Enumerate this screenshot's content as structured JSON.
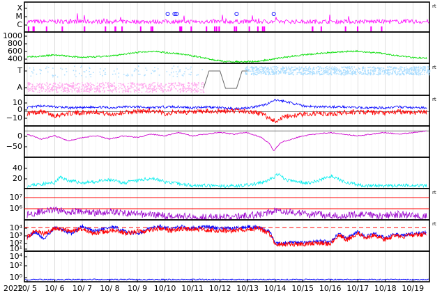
{
  "chart_data": {
    "type": "line",
    "year_label": "2022",
    "x_tick_labels": [
      "10/ 5",
      "10/ 6",
      "10/ 7",
      "10/ 8",
      "10/ 9",
      "10/10",
      "10/11",
      "10/12",
      "10/13",
      "10/14",
      "10/15",
      "10/16",
      "10/17",
      "10/18",
      "10/19"
    ],
    "x_range_days": [
      4.9,
      19.6
    ],
    "colors": {
      "xray": "#ff00ff",
      "speed": "#00dd00",
      "dens": "#00eeee",
      "bt": "#0000ff",
      "bz": "#ff0000",
      "dst": "#cc00cc",
      "pp_sector": "#aaddff",
      "m_sector": "#ffaaee",
      "e_prot": "#ffaa88",
      "e_elec": "#9900cc",
      "hp": "#0000ff",
      "hn": "#ff0000"
    },
    "panels": [
      {
        "id": "xray",
        "tick_labels": [
          "X",
          "M",
          "C"
        ],
        "rt_label": "rt",
        "flares_days": [
          10.1,
          10.35,
          10.42,
          12.6,
          13.95
        ]
      },
      {
        "id": "speed",
        "tick_labels": [
          "1000",
          "800",
          "600",
          "400"
        ],
        "ylim": [
          300,
          1050
        ],
        "series": [
          {
            "days": [
              5.0,
              5.5,
              6.0,
              6.5,
              7.0,
              7.5,
              8.0,
              8.5,
              9.0,
              9.5,
              10.0,
              10.5,
              11.0,
              11.4,
              11.8,
              12.2,
              12.6,
              13.0,
              13.4,
              13.8,
              14.2,
              14.6,
              15.0,
              15.5,
              16.0,
              16.5,
              17.0,
              17.5,
              18.0,
              18.5,
              19.0,
              19.5
            ],
            "values": [
              460,
              470,
              500,
              470,
              440,
              460,
              470,
              520,
              560,
              590,
              560,
              530,
              480,
              430,
              380,
              340,
              340,
              340,
              350,
              390,
              430,
              470,
              500,
              530,
              560,
              580,
              590,
              560,
              530,
              480,
              440,
              420
            ]
          }
        ]
      },
      {
        "id": "sector",
        "tick_labels": [
          "T",
          "A"
        ],
        "rt_label": "rt"
      },
      {
        "id": "imf",
        "tick_labels": [
          "10",
          "0",
          "−10"
        ],
        "ylim": [
          -15,
          17
        ],
        "rt_label": "rt",
        "series": [
          {
            "days": [
              5.0,
              5.5,
              6.0,
              6.5,
              7.0,
              7.5,
              8.0,
              8.5,
              9.0,
              9.5,
              10.0,
              10.5,
              11.0,
              11.5,
              12.0,
              12.5,
              13.0,
              13.5,
              13.8,
              14.0,
              14.3,
              14.6,
              15.0,
              15.5,
              16.0,
              16.5,
              17.0,
              17.5,
              18.0,
              18.5,
              19.0,
              19.5
            ],
            "values": [
              4,
              6,
              5,
              4,
              4,
              5,
              4,
              5,
              5,
              4,
              5,
              5,
              4,
              5,
              4,
              3,
              4,
              6,
              9,
              12,
              11,
              9,
              6,
              5,
              5,
              5,
              4,
              4,
              4,
              5,
              4,
              4
            ]
          },
          {
            "days": [
              5.0,
              5.5,
              6.0,
              6.5,
              7.0,
              7.5,
              8.0,
              8.5,
              9.0,
              9.5,
              10.0,
              10.5,
              11.0,
              11.5,
              12.0,
              12.5,
              13.0,
              13.5,
              13.8,
              14.0,
              14.3,
              14.6,
              15.0,
              15.5,
              16.0,
              16.5,
              17.0,
              17.5,
              18.0,
              18.5,
              19.0,
              19.5
            ],
            "values": [
              -2,
              0,
              -4,
              -2,
              -1,
              0,
              -3,
              -1,
              0,
              1,
              -2,
              0,
              -1,
              0,
              0,
              1,
              0,
              -2,
              -7,
              -10,
              -6,
              -4,
              -3,
              -2,
              -3,
              -1,
              0,
              -1,
              -2,
              0,
              -1,
              0
            ]
          }
        ]
      },
      {
        "id": "dst",
        "tick_labels": [
          "0",
          "−50"
        ],
        "ylim": [
          -80,
          15
        ],
        "series": [
          {
            "days": [
              5.0,
              5.5,
              6.0,
              6.5,
              7.0,
              7.5,
              8.0,
              8.5,
              9.0,
              9.5,
              10.0,
              10.5,
              11.0,
              11.5,
              12.0,
              12.5,
              13.0,
              13.5,
              13.8,
              13.95,
              14.2,
              14.6,
              15.0,
              15.5,
              16.0,
              16.5,
              17.0,
              17.5,
              18.0,
              18.5,
              19.0,
              19.5
            ],
            "values": [
              -10,
              -25,
              -15,
              -30,
              -20,
              -15,
              -25,
              -15,
              -20,
              -10,
              -15,
              -5,
              -15,
              -10,
              -5,
              -10,
              -5,
              -20,
              -40,
              -60,
              -35,
              -25,
              -15,
              -10,
              -5,
              -10,
              -15,
              -10,
              -5,
              -10,
              -5,
              0
            ]
          }
        ]
      },
      {
        "id": "dens",
        "tick_labels": [
          "40",
          "20"
        ],
        "ylim": [
          0,
          55
        ],
        "series": [
          {
            "days": [
              5.0,
              5.5,
              6.0,
              6.2,
              6.5,
              7.0,
              7.5,
              8.0,
              8.5,
              9.0,
              9.5,
              10.0,
              10.5,
              11.0,
              11.5,
              12.0,
              12.5,
              13.0,
              13.5,
              13.9,
              14.1,
              14.4,
              14.8,
              15.2,
              15.6,
              16.0,
              16.5,
              17.0,
              17.5,
              18.0,
              18.5,
              19.0,
              19.5
            ],
            "values": [
              5,
              8,
              10,
              20,
              14,
              10,
              12,
              15,
              10,
              14,
              18,
              12,
              8,
              6,
              5,
              4,
              5,
              6,
              10,
              18,
              25,
              15,
              12,
              10,
              14,
              22,
              12,
              6,
              5,
              4,
              5,
              6,
              5
            ]
          }
        ]
      },
      {
        "id": "electron",
        "tick_labels": [
          "10⁷",
          "10⁶"
        ],
        "rt_label": "rt",
        "series": [
          {
            "days": [
              5.0,
              5.5,
              6.0,
              6.5,
              7.0,
              7.5,
              8.0,
              8.5,
              9.0,
              9.5,
              10.0,
              10.5,
              11.0,
              11.5,
              12.0,
              12.5,
              13.0,
              13.5,
              13.9,
              14.1,
              14.4,
              14.8,
              15.2,
              15.6,
              16.0,
              16.5,
              17.0,
              17.5,
              18.0,
              18.5,
              19.0,
              19.5
            ],
            "values": [
              0.3,
              0.5,
              0.6,
              0.5,
              0.5,
              0.4,
              0.5,
              0.4,
              0.3,
              0.3,
              0.2,
              0.2,
              0.1,
              0.1,
              0.1,
              0.1,
              0.2,
              0.3,
              0.5,
              0.7,
              0.5,
              0.4,
              0.3,
              0.3,
              0.2,
              0.2,
              0.3,
              0.2,
              0.2,
              0.3,
              0.2,
              0.2
            ]
          }
        ]
      },
      {
        "id": "goes_mag",
        "tick_labels": [
          "10⁴",
          "10³",
          "10²",
          "10¹"
        ],
        "rt_label": "rt",
        "threshold_label": "10⁴",
        "series": [
          {
            "days": [
              5.0,
              5.3,
              5.6,
              6.0,
              6.3,
              6.6,
              7.0,
              7.4,
              7.8,
              8.2,
              8.6,
              9.0,
              9.4,
              9.8,
              10.2,
              10.6,
              11.0,
              11.5,
              12.0,
              12.5,
              13.0,
              13.4,
              13.8,
              14.0,
              14.5,
              15.0,
              15.5,
              16.0,
              16.3,
              16.6,
              17.0,
              17.3,
              17.6,
              18.0,
              18.3,
              18.6,
              19.0,
              19.5
            ],
            "values": [
              1.8,
              2.4,
              1.5,
              3.0,
              2.6,
              2.2,
              3.2,
              2.5,
              2.9,
              3.0,
              2.4,
              2.2,
              2.8,
              3.2,
              2.8,
              3.1,
              2.9,
              3.1,
              2.9,
              2.9,
              3.1,
              3.0,
              2.5,
              0.9,
              1.0,
              1.0,
              1.2,
              1.1,
              2.2,
              1.6,
              2.4,
              1.8,
              2.2,
              1.6,
              2.1,
              2.0,
              2.2,
              2.4
            ]
          },
          {
            "days": [
              5.0,
              5.3,
              5.6,
              6.0,
              6.3,
              6.6,
              7.0,
              7.4,
              7.8,
              8.2,
              8.6,
              9.0,
              9.4,
              9.8,
              10.2,
              10.6,
              11.0,
              11.5,
              12.0,
              12.5,
              13.0,
              13.4,
              13.8,
              14.0,
              14.5,
              15.0,
              15.5,
              16.0,
              16.3,
              16.6,
              17.0,
              17.3,
              17.6,
              18.0,
              18.3,
              18.6,
              19.0,
              19.5
            ],
            "values": [
              1.7,
              2.6,
              2.2,
              2.9,
              2.7,
              2.5,
              2.8,
              2.3,
              2.4,
              2.7,
              2.2,
              2.5,
              2.6,
              2.9,
              2.6,
              2.8,
              2.8,
              2.7,
              2.6,
              2.6,
              2.7,
              2.9,
              2.2,
              0.8,
              0.8,
              0.8,
              1.0,
              0.9,
              2.0,
              1.4,
              2.3,
              1.6,
              2.0,
              1.4,
              1.9,
              1.8,
              2.0,
              2.1
            ]
          }
        ]
      },
      {
        "id": "proton",
        "tick_labels": [
          "10⁴",
          "10²",
          "10⁰"
        ]
      }
    ]
  }
}
